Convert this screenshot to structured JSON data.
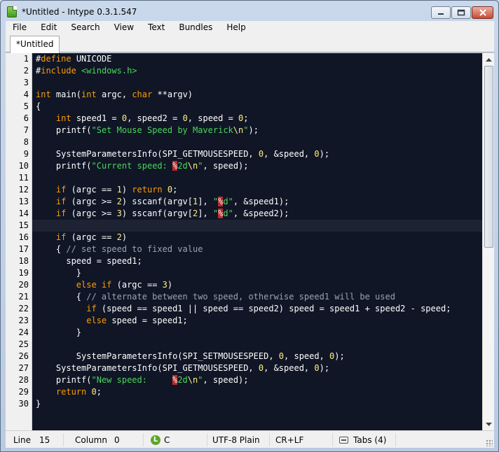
{
  "window": {
    "title": "*Untitled - Intype 0.3.1.547",
    "buttons": {
      "minimize": "minimize",
      "maximize": "maximize",
      "close": "close"
    }
  },
  "menu": [
    "File",
    "Edit",
    "Search",
    "View",
    "Text",
    "Bundles",
    "Help"
  ],
  "tabs": [
    {
      "label": "*Untitled",
      "active": true
    }
  ],
  "editor": {
    "current_line": 15,
    "line_numbers": [
      "1",
      "2",
      "3",
      "4",
      "5",
      "6",
      "7",
      "8",
      "9",
      "10",
      "11",
      "12",
      "13",
      "14",
      "15",
      "16",
      "17",
      "18",
      "19",
      "20",
      "21",
      "22",
      "23",
      "24",
      "25",
      "26",
      "27",
      "28",
      "29",
      "30"
    ],
    "lines": [
      "#define UNICODE",
      "#include <windows.h>",
      "",
      "int main(int argc, char **argv)",
      "{",
      "    int speed1 = 0, speed2 = 0, speed = 0;",
      "    printf(\"Set Mouse Speed by Maverick\\n\");",
      "",
      "    SystemParametersInfo(SPI_GETMOUSESPEED, 0, &speed, 0);",
      "    printf(\"Current speed: %2d\\n\", speed);",
      "",
      "    if (argc == 1) return 0;",
      "    if (argc >= 2) sscanf(argv[1], \"%d\", &speed1);",
      "    if (argc >= 3) sscanf(argv[2], \"%d\", &speed2);",
      "",
      "    if (argc == 2)",
      "    { // set speed to fixed value",
      "      speed = speed1;",
      "        }",
      "        else if (argc == 3)",
      "        { // alternate between two speed, otherwise speed1 will be used",
      "          if (speed == speed1 || speed == speed2) speed = speed1 + speed2 - speed;",
      "          else speed = speed1;",
      "        }",
      "",
      "        SystemParametersInfo(SPI_SETMOUSESPEED, 0, speed, 0);",
      "    SystemParametersInfo(SPI_GETMOUSESPEED, 0, &speed, 0);",
      "    printf(\"New speed:     %2d\\n\", speed);",
      "    return 0;",
      "}"
    ],
    "colors": {
      "background": "#101626",
      "current_line": "#1d2333",
      "keyword": "#ff9d00",
      "number": "#ffee80",
      "string": "#4ad65a",
      "comment": "#9aa3b3",
      "format_specifier_bg": "#c0282d"
    }
  },
  "status": {
    "line_label": "Line",
    "line_value": "15",
    "column_label": "Column",
    "column_value": "0",
    "language_badge": "L",
    "language": "C",
    "encoding": "UTF-8 Plain",
    "line_endings": "CR+LF",
    "indent": "Tabs (4)"
  }
}
